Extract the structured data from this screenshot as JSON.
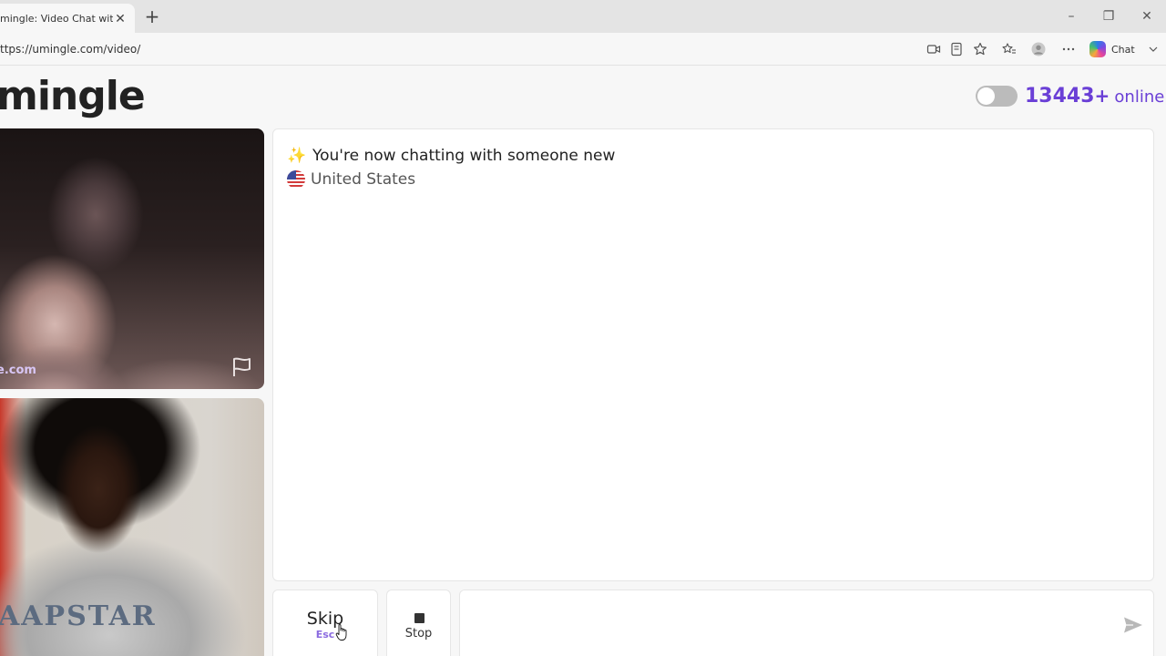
{
  "browser": {
    "tab_title": "mingle: Video Chat with Stra",
    "url": "ttps://umingle.com/video/",
    "chat_label": "Chat"
  },
  "site": {
    "logo": "mingle",
    "online_count": "13443",
    "online_plus": "+",
    "online_label": "online"
  },
  "videos": {
    "watermark": "e.com",
    "shirt_text": "AAPSTAR"
  },
  "chat": {
    "status_text": "You're now chatting with someone new",
    "country": "United States",
    "input_value": "",
    "input_placeholder": ""
  },
  "controls": {
    "skip_label": "Skip",
    "skip_key": "Esc",
    "stop_label": "Stop"
  },
  "colors": {
    "accent_purple": "#6a3fd6",
    "skip_key_purple": "#8a6ae0",
    "panel_bg": "#ffffff",
    "page_bg": "#f7f7f7"
  },
  "icons": {
    "sparkle": "sparkle-icon",
    "flag_country": "us-flag-icon",
    "report": "report-flag-icon",
    "send": "send-icon",
    "stop": "stop-square-icon"
  }
}
